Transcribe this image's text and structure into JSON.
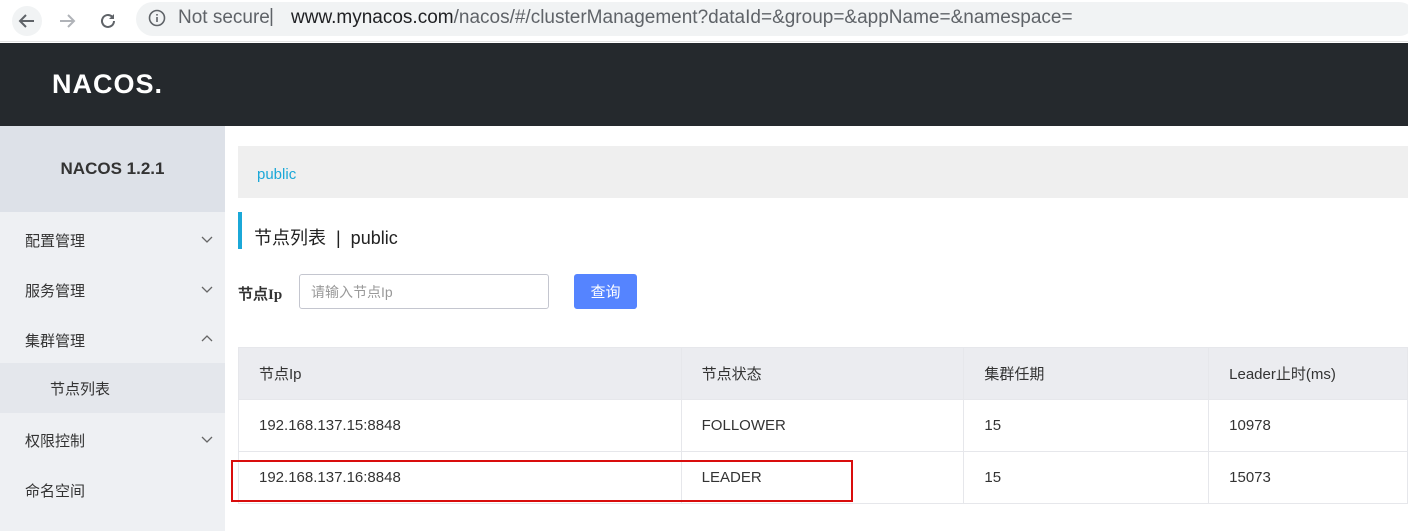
{
  "browser": {
    "security_label": "Not secure",
    "separator": "|",
    "url_host": "www.mynacos.com",
    "url_path": "/nacos/#/clusterManagement?dataId=&group=&appName=&namespace="
  },
  "header": {
    "logo_text": "NACOS."
  },
  "sidebar": {
    "version": "NACOS 1.2.1",
    "items": [
      {
        "label": "配置管理",
        "icon": "chevron-down-icon"
      },
      {
        "label": "服务管理",
        "icon": "chevron-down-icon"
      },
      {
        "label": "集群管理",
        "icon": "chevron-up-icon"
      },
      {
        "label": "权限控制",
        "icon": "chevron-down-icon"
      },
      {
        "label": "命名空间"
      }
    ],
    "subitems": [
      {
        "label": "节点列表"
      }
    ]
  },
  "main": {
    "breadcrumb": "public",
    "title": "节点列表  |  public",
    "filter_label": "节点Ip",
    "filter_placeholder": "请输入节点Ip",
    "query_button": "查询",
    "table": {
      "columns": [
        "节点Ip",
        "节点状态",
        "集群任期",
        "Leader止时(ms)"
      ],
      "rows": [
        [
          "192.168.137.15:8848",
          "FOLLOWER",
          "15",
          "10978"
        ],
        [
          "192.168.137.16:8848",
          "LEADER",
          "15",
          "15073"
        ]
      ]
    }
  },
  "colors": {
    "accent": "#1ba8d8",
    "primary_button": "#5584ff",
    "header_bg": "#25292d",
    "highlight": "#d90d0d"
  }
}
